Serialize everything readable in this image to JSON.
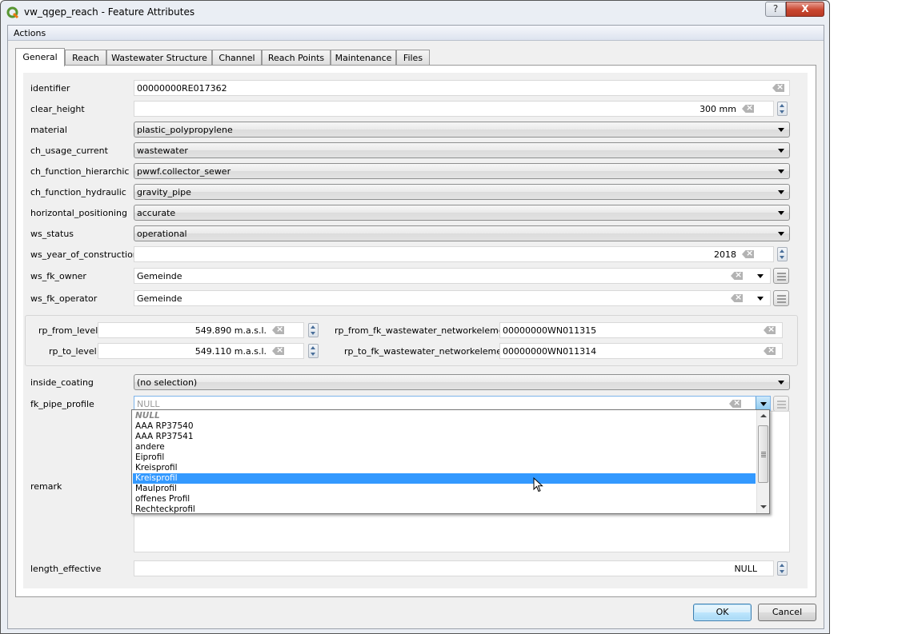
{
  "window": {
    "title": "vw_qgep_reach - Feature Attributes",
    "help_label": "?",
    "close_label": "X"
  },
  "actions_bar": {
    "label": "Actions"
  },
  "tabs": [
    {
      "label": "General",
      "active": true
    },
    {
      "label": "Reach"
    },
    {
      "label": "Wastewater Structure"
    },
    {
      "label": "Channel"
    },
    {
      "label": "Reach Points"
    },
    {
      "label": "Maintenance"
    },
    {
      "label": "Files"
    }
  ],
  "fields": {
    "identifier": {
      "label": "identifier",
      "value": "00000000RE017362"
    },
    "clear_height": {
      "label": "clear_height",
      "value": "300 mm"
    },
    "material": {
      "label": "material",
      "value": "plastic_polypropylene"
    },
    "ch_usage_current": {
      "label": "ch_usage_current",
      "value": "wastewater"
    },
    "ch_function_hierarchic": {
      "label": "ch_function_hierarchic",
      "value": "pwwf.collector_sewer"
    },
    "ch_function_hydraulic": {
      "label": "ch_function_hydraulic",
      "value": "gravity_pipe"
    },
    "horizontal_positioning": {
      "label": "horizontal_positioning",
      "value": "accurate"
    },
    "ws_status": {
      "label": "ws_status",
      "value": "operational"
    },
    "ws_year_of_construction": {
      "label": "ws_year_of_construction",
      "value": "2018"
    },
    "ws_fk_owner": {
      "label": "ws_fk_owner",
      "value": "Gemeinde"
    },
    "ws_fk_operator": {
      "label": "ws_fk_operator",
      "value": "Gemeinde"
    },
    "rp_from_level": {
      "label": "rp_from_level",
      "value": "549.890 m.a.s.l."
    },
    "rp_to_level": {
      "label": "rp_to_level",
      "value": "549.110 m.a.s.l."
    },
    "rp_from_fk_wastewater_networkelement": {
      "label": "rp_from_fk_wastewater_networkelement",
      "value": "00000000WN011315"
    },
    "rp_to_fk_wastewater_networkelement": {
      "label": "rp_to_fk_wastewater_networkelement",
      "value": "00000000WN011314"
    },
    "inside_coating": {
      "label": "inside_coating",
      "value": "(no selection)"
    },
    "fk_pipe_profile": {
      "label": "fk_pipe_profile",
      "placeholder": "NULL"
    },
    "remark": {
      "label": "remark",
      "value": ""
    },
    "length_effective": {
      "label": "length_effective",
      "value": "NULL"
    }
  },
  "pipe_profile_dropdown": {
    "options": [
      "NULL",
      "AAA RP37540",
      "AAA RP37541",
      "andere",
      "Eiprofil",
      "Kreisprofil",
      "Kreisprofil",
      "Maulprofil",
      "offenes Profil",
      "Rechteckprofil"
    ],
    "highlighted_index": 6
  },
  "buttons": {
    "ok": "OK",
    "cancel": "Cancel"
  },
  "colors": {
    "selection": "#3399ff",
    "close_button": "#c9462f"
  }
}
